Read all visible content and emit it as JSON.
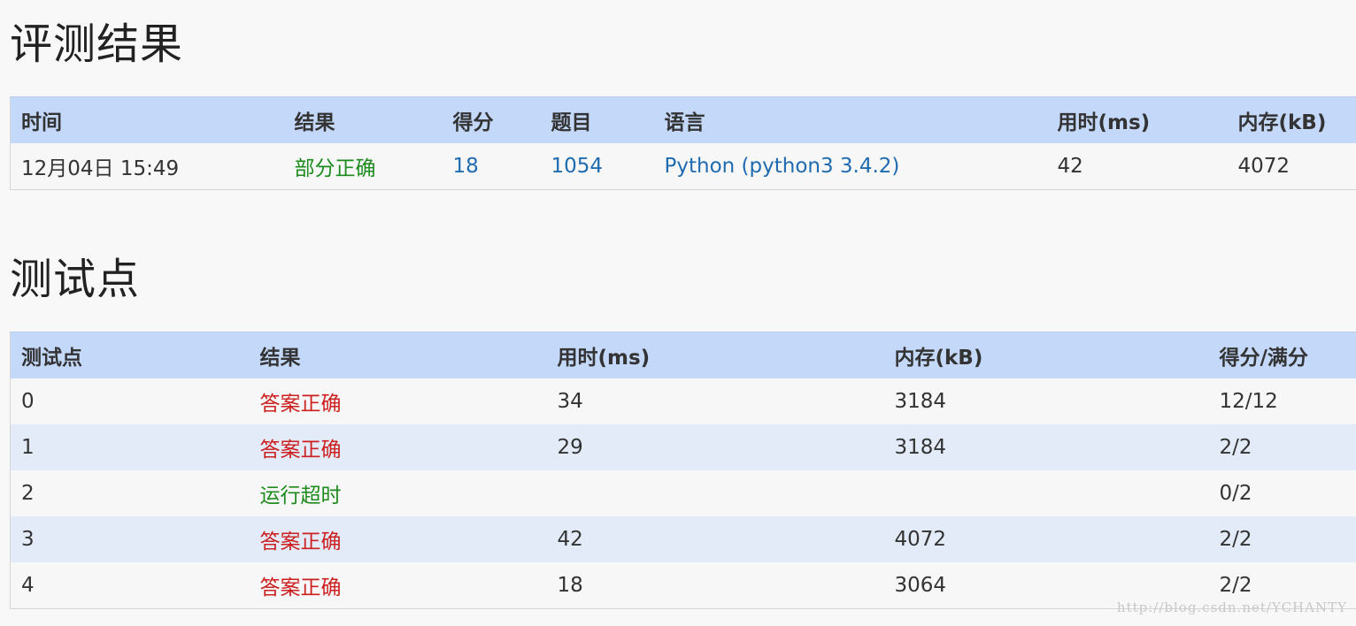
{
  "result_section": {
    "title": "评测结果",
    "headers": [
      "时间",
      "结果",
      "得分",
      "题目",
      "语言",
      "用时(ms)",
      "内存(kB)"
    ],
    "row": {
      "time": "12月04日 15:49",
      "result": "部分正确",
      "score": "18",
      "problem": "1054",
      "language": "Python (python3 3.4.2)",
      "duration": "42",
      "memory": "4072"
    }
  },
  "cases_section": {
    "title": "测试点",
    "headers": [
      "测试点",
      "结果",
      "用时(ms)",
      "内存(kB)",
      "得分/满分"
    ],
    "rows": [
      {
        "id": "0",
        "result": "答案正确",
        "duration": "34",
        "memory": "3184",
        "score": "12/12",
        "status": "correct"
      },
      {
        "id": "1",
        "result": "答案正确",
        "duration": "29",
        "memory": "3184",
        "score": "2/2",
        "status": "correct"
      },
      {
        "id": "2",
        "result": "运行超时",
        "duration": "",
        "memory": "",
        "score": "0/2",
        "status": "timeout"
      },
      {
        "id": "3",
        "result": "答案正确",
        "duration": "42",
        "memory": "4072",
        "score": "2/2",
        "status": "correct"
      },
      {
        "id": "4",
        "result": "答案正确",
        "duration": "18",
        "memory": "3064",
        "score": "2/2",
        "status": "correct"
      }
    ]
  },
  "watermark": "http://blog.csdn.net/YCHANTY",
  "colors": {
    "header_bg": "#c4d8fa",
    "link_blue": "#1f6bb0",
    "partial_green": "#1c8a1c",
    "correct_red": "#cc1f1f",
    "alt_row": "#e3ebf8"
  }
}
